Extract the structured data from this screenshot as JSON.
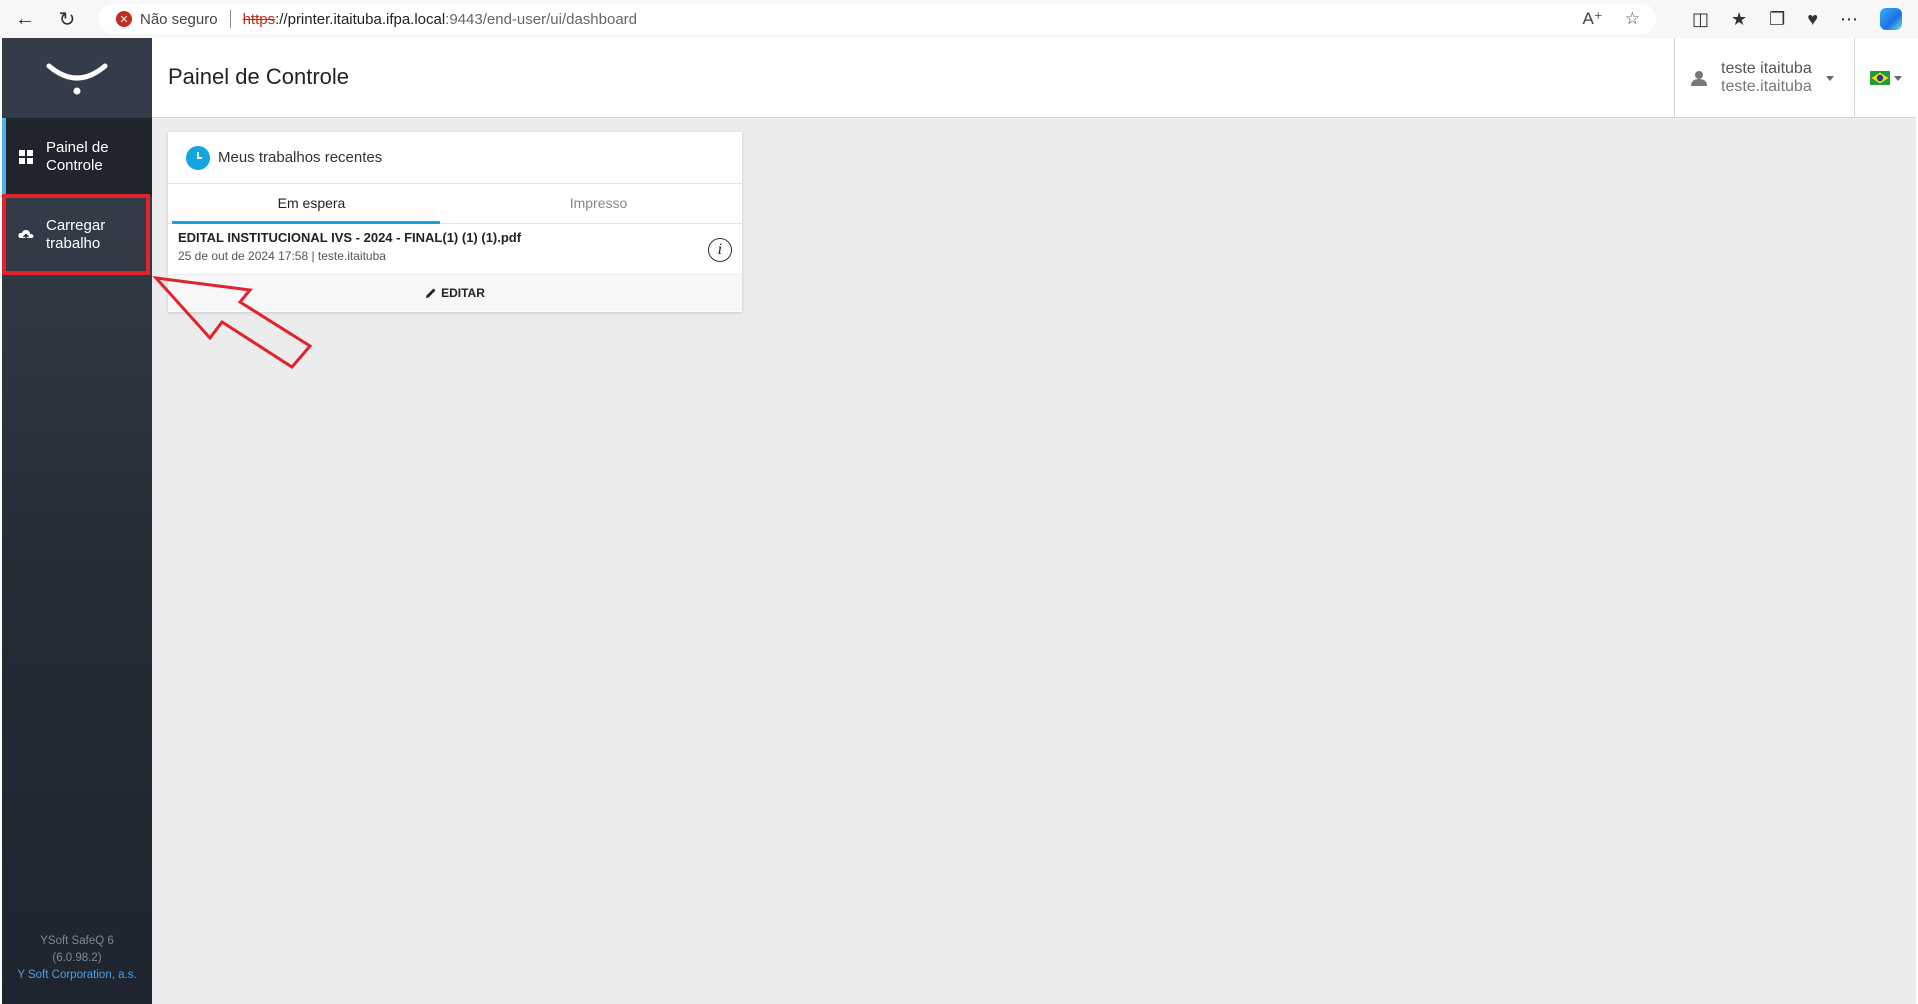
{
  "browser": {
    "security_label": "Não seguro",
    "url_scheme": "https",
    "url_host": "://printer.itaituba.ifpa.local",
    "url_path": ":9443/end-user/ui/dashboard"
  },
  "sidebar": {
    "items": [
      {
        "label": "Painel de Controle",
        "icon": "grid-icon",
        "active": true
      },
      {
        "label": "Carregar trabalho",
        "icon": "upload-cloud-icon",
        "active": false
      }
    ],
    "footer": {
      "product": "YSoft SafeQ 6",
      "version": "(6.0.98.2)",
      "company": "Y Soft Corporation, a.s."
    }
  },
  "header": {
    "title": "Painel de Controle",
    "user_name": "teste itaituba",
    "user_login": "teste.itaituba",
    "language_flag": "brazil-flag-icon"
  },
  "recent_jobs": {
    "title": "Meus trabalhos recentes",
    "tabs": [
      {
        "label": "Em espera",
        "active": true
      },
      {
        "label": "Impresso",
        "active": false
      }
    ],
    "job": {
      "name": "EDITAL INSTITUCIONAL IVS - 2024 - FINAL(1) (1) (1).pdf",
      "meta": "25 de out de 2024 17:58 | teste.itaituba"
    },
    "edit_label": "EDITAR"
  },
  "colors": {
    "accent": "#1aa0e0",
    "highlight": "#e0232c",
    "sidebar": "#262c36"
  }
}
